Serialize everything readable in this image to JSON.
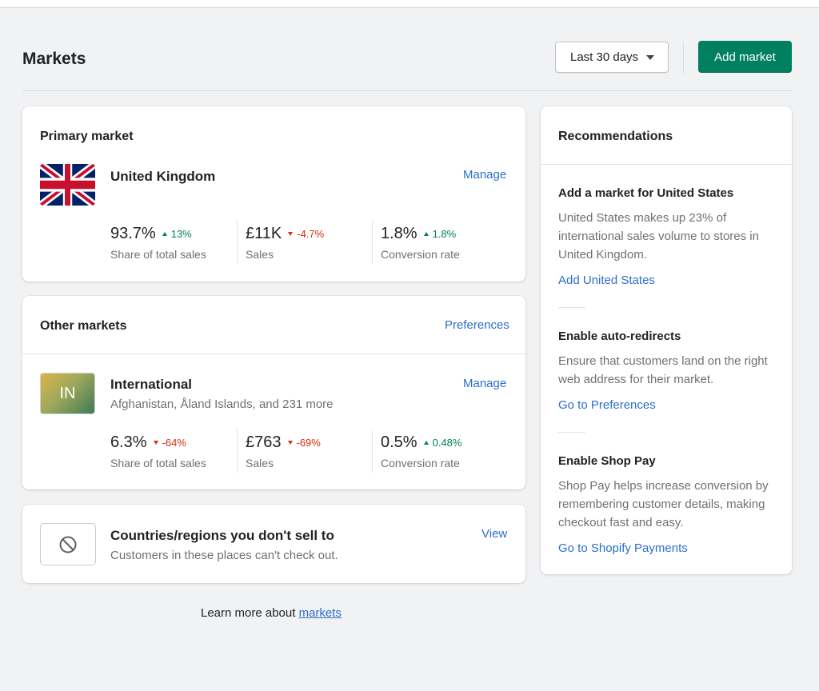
{
  "header": {
    "title": "Markets",
    "date_range": "Last 30 days",
    "add_market_label": "Add market"
  },
  "primary": {
    "title": "Primary market",
    "market_name": "United Kingdom",
    "manage_label": "Manage",
    "metrics": [
      {
        "value": "93.7%",
        "change": "13%",
        "direction": "up",
        "label": "Share of total sales"
      },
      {
        "value": "£11K",
        "change": "-4.7%",
        "direction": "down",
        "label": "Sales"
      },
      {
        "value": "1.8%",
        "change": "1.8%",
        "direction": "up",
        "label": "Conversion rate"
      }
    ]
  },
  "other": {
    "title": "Other markets",
    "preferences_label": "Preferences",
    "market_code": "IN",
    "market_name": "International",
    "market_subtitle": "Afghanistan, Åland Islands, and 231 more",
    "manage_label": "Manage",
    "metrics": [
      {
        "value": "6.3%",
        "change": "-64%",
        "direction": "down",
        "label": "Share of total sales"
      },
      {
        "value": "£763",
        "change": "-69%",
        "direction": "down",
        "label": "Sales"
      },
      {
        "value": "0.5%",
        "change": "0.48%",
        "direction": "up",
        "label": "Conversion rate"
      }
    ]
  },
  "unsold": {
    "title": "Countries/regions you don't sell to",
    "subtitle": "Customers in these places can't check out.",
    "view_label": "View",
    "icon": "block-icon"
  },
  "recommendations": {
    "title": "Recommendations",
    "items": [
      {
        "heading": "Add a market for United States",
        "body": "United States makes up 23% of international sales volume to stores in United Kingdom.",
        "link": "Add United States"
      },
      {
        "heading": "Enable auto-redirects",
        "body": "Ensure that customers land on the right web address for their market.",
        "link": "Go to Preferences"
      },
      {
        "heading": "Enable Shop Pay",
        "body": "Shop Pay helps increase conversion by remembering customer details, making checkout fast and easy.",
        "link": "Go to Shopify Payments"
      }
    ]
  },
  "footer": {
    "text": "Learn more about",
    "link": "markets"
  },
  "colors": {
    "accent": "#008060",
    "link": "#2c6ecb",
    "positive": "#008060",
    "negative": "#d72c0d"
  }
}
